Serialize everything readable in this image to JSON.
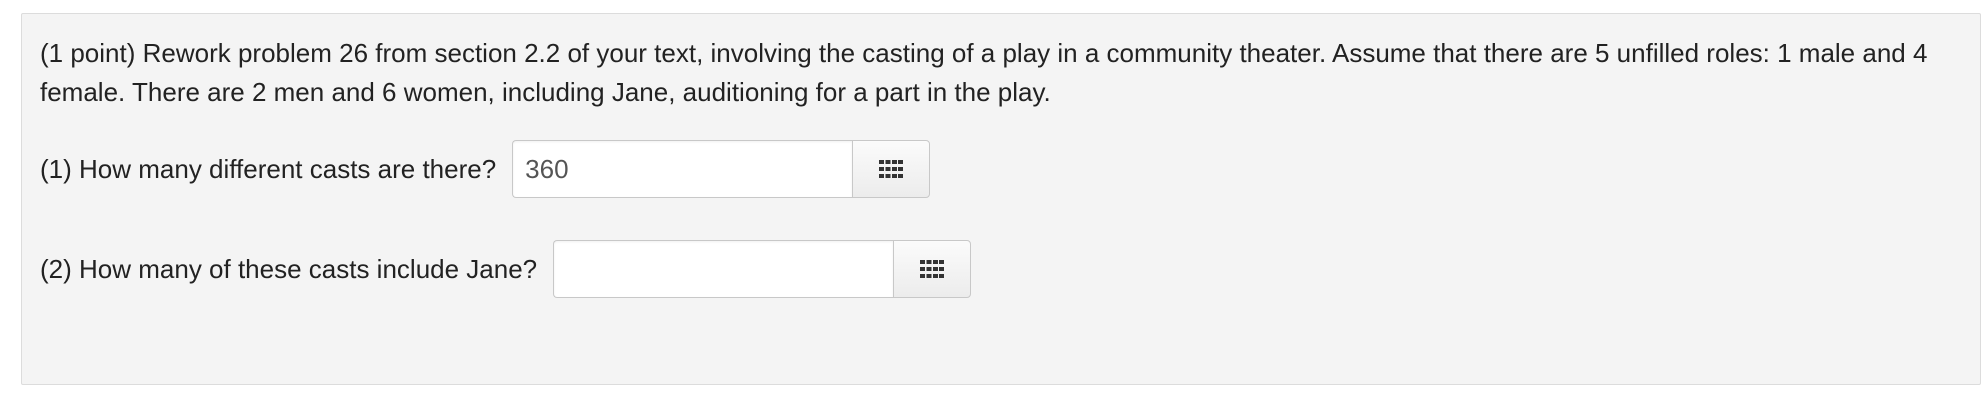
{
  "problem": {
    "text": "(1 point) Rework problem 26 from section 2.2 of your text, involving the casting of a play in a community theater. Assume that there are 5 unfilled roles: 1 male and 4 female. There are 2 men and 6 women, including Jane, auditioning for a part in the play."
  },
  "questions": [
    {
      "label": "(1) How many different casts are there?",
      "answer_value": "360",
      "palette_icon": "grid-icon"
    },
    {
      "label": "(2) How many of these casts include Jane?",
      "answer_value": "",
      "palette_icon": "grid-icon"
    }
  ],
  "colors": {
    "panel_background": "#f4f4f4",
    "panel_border": "#dcdcdc",
    "icon": "#333333"
  }
}
